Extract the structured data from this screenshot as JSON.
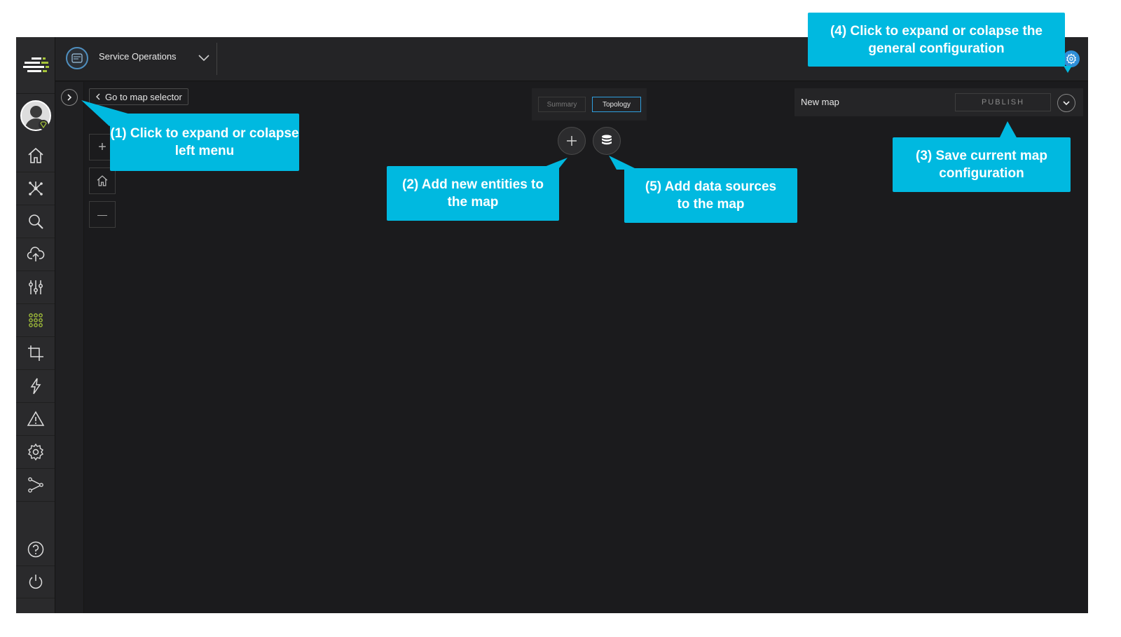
{
  "header": {
    "service_title": "Service Operations"
  },
  "nav": {
    "items": [
      {
        "icon": "home-icon"
      },
      {
        "icon": "topology-icon"
      },
      {
        "icon": "search-icon"
      },
      {
        "icon": "cloud-upload-icon"
      },
      {
        "icon": "sliders-icon"
      },
      {
        "icon": "apps-grid-icon"
      },
      {
        "icon": "crop-icon"
      },
      {
        "icon": "lightning-icon"
      },
      {
        "icon": "warning-icon"
      },
      {
        "icon": "settings-icon"
      },
      {
        "icon": "share-icon"
      },
      {
        "icon": "help-icon"
      },
      {
        "icon": "power-icon"
      }
    ]
  },
  "map": {
    "go_to_selector": "Go to map selector",
    "zoom_in": "+",
    "zoom_out": "—"
  },
  "tabs": [
    {
      "label": "Summary",
      "active": false
    },
    {
      "label": "Topology",
      "active": true
    }
  ],
  "config": {
    "map_name": "New map",
    "publish_label": "PUBLISH"
  },
  "callouts": {
    "c1": "(1) Click to expand or colapse left menu",
    "c2": "(2) Add new entities to the map",
    "c3": "(3) Save current map configuration",
    "c4": "(4) Click to expand or colapse the general configuration",
    "c5": "(5) Add data sources to the map"
  },
  "colors": {
    "callout": "#00b9e0",
    "accent_green": "#a6c43a",
    "accent_blue": "#2f9fe0"
  }
}
